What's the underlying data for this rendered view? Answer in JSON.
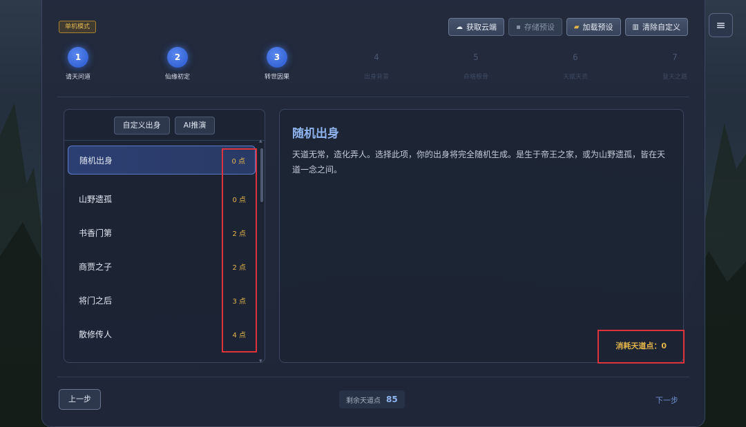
{
  "mode_badge": "单机模式",
  "toolbar": {
    "fetch_cloud": {
      "icon": "cloud-icon",
      "glyph": "☁",
      "label": "获取云端"
    },
    "save_preset": {
      "icon": "save-icon",
      "glyph": "▪",
      "label": "存储预设"
    },
    "load_preset": {
      "icon": "folder-icon",
      "glyph": "▰",
      "label": "加载预设"
    },
    "clear_custom": {
      "icon": "trash-icon",
      "glyph": "▥",
      "label": "清除自定义"
    }
  },
  "steps": [
    {
      "num": "1",
      "label": "请天问道",
      "active": true
    },
    {
      "num": "2",
      "label": "仙缘初定",
      "active": true
    },
    {
      "num": "3",
      "label": "转世因果",
      "active": true
    },
    {
      "num": "4",
      "label": "出身背景",
      "active": false
    },
    {
      "num": "5",
      "label": "命格根骨",
      "active": false
    },
    {
      "num": "6",
      "label": "天赋天资",
      "active": false
    },
    {
      "num": "7",
      "label": "登天之路",
      "active": false
    }
  ],
  "left_tabs": {
    "custom": "自定义出身",
    "ai": "AI推演"
  },
  "origins": [
    {
      "name": "随机出身",
      "cost": "0 点",
      "selected": true
    },
    {
      "name": "山野遗孤",
      "cost": "0 点",
      "selected": false
    },
    {
      "name": "书香门第",
      "cost": "2 点",
      "selected": false
    },
    {
      "name": "商贾之子",
      "cost": "2 点",
      "selected": false
    },
    {
      "name": "将门之后",
      "cost": "3 点",
      "selected": false
    },
    {
      "name": "散修传人",
      "cost": "4 点",
      "selected": false
    }
  ],
  "detail": {
    "title": "随机出身",
    "description": "天道无常，造化弄人。选择此项，你的出身将完全随机生成。是生于帝王之家，或为山野遗孤，皆在天道一念之间。",
    "consume_label": "消耗天道点：",
    "consume_value": "0"
  },
  "footer": {
    "prev": "上一步",
    "remaining_label": "剩余天道点",
    "remaining_value": "85",
    "next": "下一步"
  },
  "menu_icon": "≡",
  "colors": {
    "accent_blue": "#3566d8",
    "gold": "#e6b64a",
    "highlight_red": "#e0323a"
  }
}
